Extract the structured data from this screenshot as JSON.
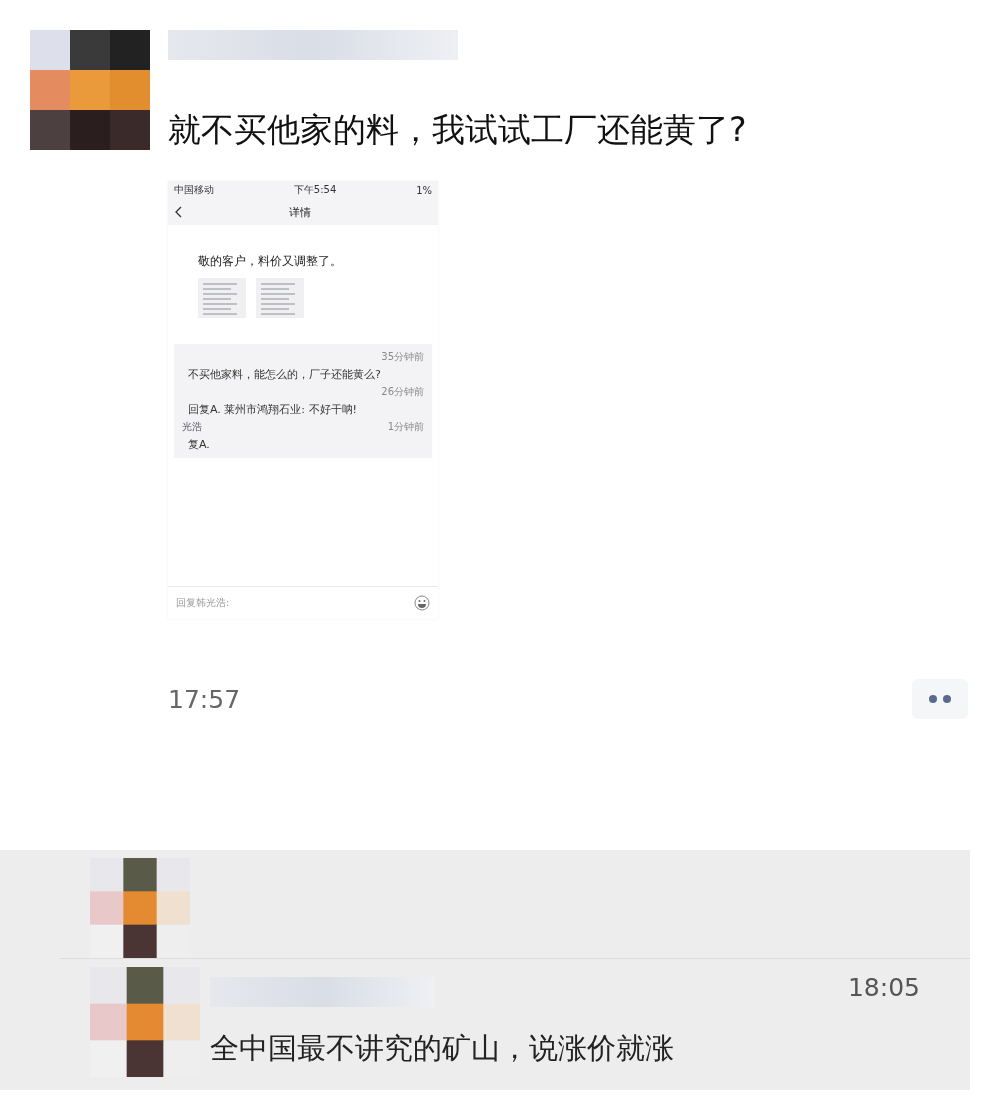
{
  "post": {
    "text": "就不买他家的料，我试试工厂还能黄了?",
    "time": "17:57"
  },
  "shared_screenshot": {
    "status_bar": {
      "carrier": "中国移动",
      "time": "下午5:54",
      "battery": "1%"
    },
    "title": "详情",
    "post_text": "敬的客户，料价又调整了。",
    "comments": [
      {
        "time": "35分钟前",
        "text": "不买他家料，能怎么的，厂子还能黄么?"
      },
      {
        "time": "26分钟前",
        "text": "回复A. 莱州市鸿翔石业: 不好干呐!"
      },
      {
        "name": "光浩",
        "time": "1分钟前",
        "text": "复A."
      }
    ],
    "reply_placeholder": "回复韩光浩:"
  },
  "comments": [
    {
      "kind": "likes"
    },
    {
      "kind": "comment",
      "time": "18:05",
      "text": "全中国最不讲究的矿山，说涨价就涨"
    }
  ]
}
